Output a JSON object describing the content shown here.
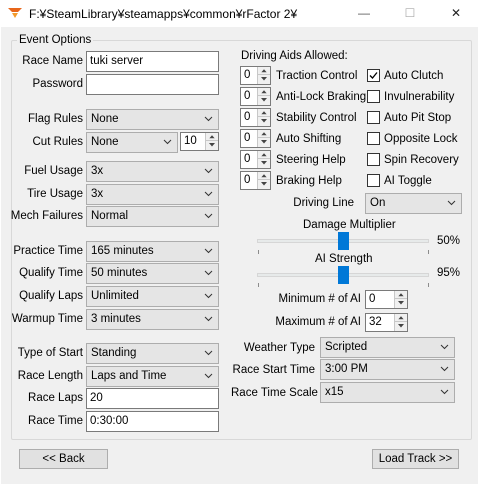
{
  "window": {
    "title": "F:¥SteamLibrary¥steamapps¥common¥rFactor 2¥",
    "minimize_glyph": "—",
    "maximize_glyph": "☐",
    "close_glyph": "✕",
    "icon": "rfactor-app-icon"
  },
  "event_options": {
    "group_label": "Event Options",
    "race_name": {
      "label": "Race Name",
      "value": "tuki server"
    },
    "password": {
      "label": "Password",
      "value": ""
    },
    "flag_rules": {
      "label": "Flag Rules",
      "value": "None"
    },
    "cut_rules": {
      "label": "Cut Rules",
      "value": "None",
      "spin_value": "10"
    },
    "fuel_usage": {
      "label": "Fuel Usage",
      "value": "3x"
    },
    "tire_usage": {
      "label": "Tire Usage",
      "value": "3x"
    },
    "mech_failures": {
      "label": "Mech Failures",
      "value": "Normal"
    },
    "practice_time": {
      "label": "Practice Time",
      "value": "165 minutes"
    },
    "qualify_time": {
      "label": "Qualify Time",
      "value": "50 minutes"
    },
    "qualify_laps": {
      "label": "Qualify Laps",
      "value": "Unlimited"
    },
    "warmup_time": {
      "label": "Warmup Time",
      "value": "3 minutes"
    },
    "type_of_start": {
      "label": "Type of Start",
      "value": "Standing"
    },
    "race_length": {
      "label": "Race Length",
      "value": "Laps and Time"
    },
    "race_laps": {
      "label": "Race Laps",
      "value": "20"
    },
    "race_time": {
      "label": "Race Time",
      "value": "0:30:00"
    }
  },
  "driving_aids": {
    "heading": "Driving Aids Allowed:",
    "spinners": [
      {
        "label": "Traction Control",
        "value": "0"
      },
      {
        "label": "Anti-Lock Braking",
        "value": "0"
      },
      {
        "label": "Stability Control",
        "value": "0"
      },
      {
        "label": "Auto Shifting",
        "value": "0"
      },
      {
        "label": "Steering Help",
        "value": "0"
      },
      {
        "label": "Braking Help",
        "value": "0"
      }
    ],
    "checkboxes": [
      {
        "label": "Auto Clutch",
        "checked": true
      },
      {
        "label": "Invulnerability",
        "checked": false
      },
      {
        "label": "Auto Pit Stop",
        "checked": false
      },
      {
        "label": "Opposite Lock",
        "checked": false
      },
      {
        "label": "Spin Recovery",
        "checked": false
      },
      {
        "label": "AI Toggle",
        "checked": false
      }
    ],
    "driving_line": {
      "label": "Driving Line",
      "value": "On"
    }
  },
  "sliders": {
    "damage_multiplier": {
      "label": "Damage Multiplier",
      "value_text": "50%",
      "fraction": 0.5
    },
    "ai_strength": {
      "label": "AI Strength",
      "value_text": "95%",
      "fraction": 0.5
    }
  },
  "ai_counts": {
    "minimum": {
      "label": "Minimum # of AI",
      "value": "0"
    },
    "maximum": {
      "label": "Maximum # of AI",
      "value": "32"
    }
  },
  "conditions": {
    "weather_type": {
      "label": "Weather Type",
      "value": "Scripted"
    },
    "race_start_time": {
      "label": "Race Start Time",
      "value": "3:00 PM"
    },
    "race_time_scale": {
      "label": "Race Time Scale",
      "value": "x15"
    }
  },
  "footer": {
    "back_label": "<< Back",
    "next_label": "Load Track >>"
  },
  "colors": {
    "slider_thumb": "#0078d7",
    "dialog_bg": "#f0f0f0"
  }
}
